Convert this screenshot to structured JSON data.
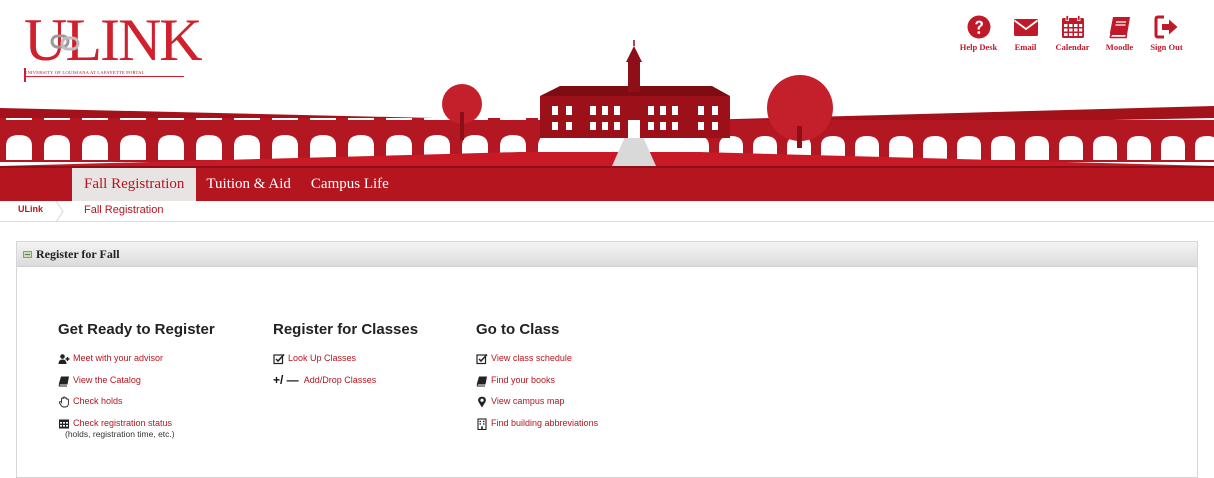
{
  "header": {
    "logo_text": "ULINK",
    "logo_subtitle": "UNIVERSITY OF LOUISIANA AT LAFAYETTE PORTAL",
    "tools": [
      {
        "label": "Help Desk",
        "icon": "question-icon"
      },
      {
        "label": "Email",
        "icon": "envelope-icon"
      },
      {
        "label": "Calendar",
        "icon": "calendar-icon"
      },
      {
        "label": "Moodle",
        "icon": "book-icon"
      },
      {
        "label": "Sign Out",
        "icon": "sign-out-icon"
      }
    ]
  },
  "colors": {
    "brand_red": "#b5151f",
    "logo_red": "#d0202e",
    "active_tab_bg": "#e9e4e4"
  },
  "nav": {
    "tabs": [
      "Fall Registration",
      "Tuition & Aid",
      "Campus Life"
    ],
    "active_tab": "Fall Registration"
  },
  "breadcrumb": {
    "home": "ULink",
    "current": "Fall Registration"
  },
  "panel": {
    "title": "Register for Fall",
    "columns": [
      {
        "title": "Get Ready to Register",
        "items": [
          {
            "label": "Meet with your advisor",
            "icon": "user-plus-icon"
          },
          {
            "label": "View the Catalog",
            "icon": "book-icon"
          },
          {
            "label": "Check holds",
            "icon": "hand-icon"
          },
          {
            "label": "Check registration status",
            "icon": "calendar-table-icon",
            "sub": "(holds, registration time, etc.)"
          }
        ]
      },
      {
        "title": "Register for Classes",
        "items": [
          {
            "label": "Look Up Classes",
            "icon": "checkbox-icon"
          },
          {
            "label": "Add/Drop Classes",
            "icon": "plus-minus-icon",
            "symbol": "+/ —"
          }
        ]
      },
      {
        "title": "Go to Class",
        "items": [
          {
            "label": "View class schedule",
            "icon": "checkbox-icon"
          },
          {
            "label": "Find your books",
            "icon": "book-icon"
          },
          {
            "label": "View campus map",
            "icon": "map-marker-icon"
          },
          {
            "label": "Find building abbreviations",
            "icon": "building-icon"
          }
        ]
      }
    ]
  }
}
